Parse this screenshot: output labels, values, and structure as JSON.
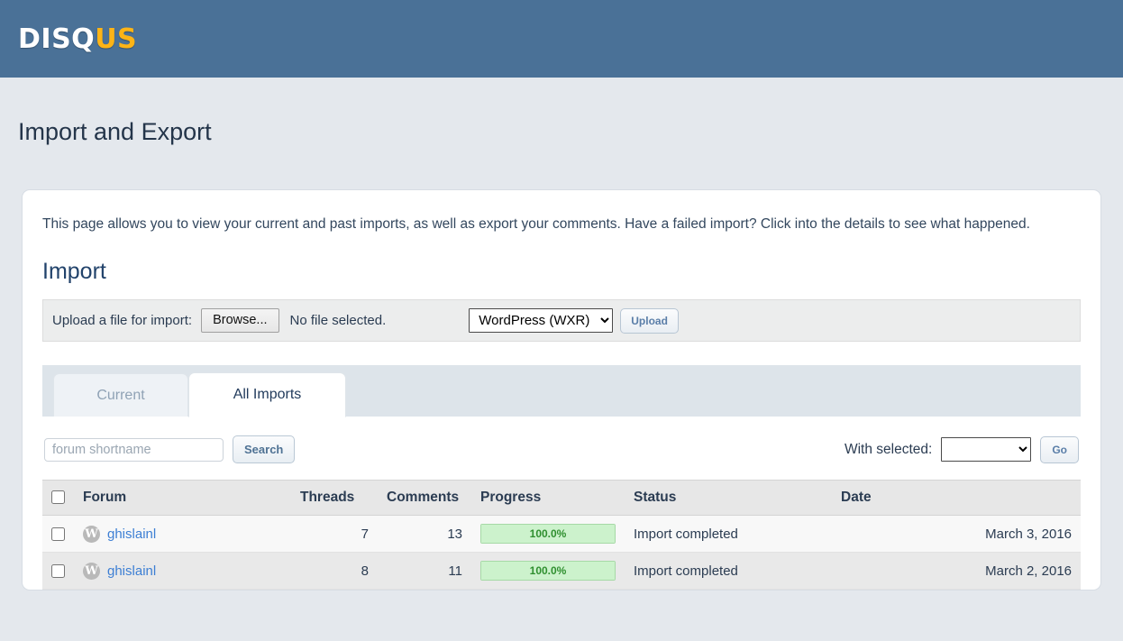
{
  "brand": {
    "logo_white": "DISQ",
    "logo_orange": "US"
  },
  "page": {
    "title": "Import and Export",
    "intro": "This page allows you to view your current and past imports, as well as export your comments. Have a failed import? Click into the details to see what happened."
  },
  "import_section": {
    "heading": "Import",
    "upload_label": "Upload a file for import:",
    "browse_button": "Browse...",
    "no_file_text": "No file selected.",
    "format_selected": "WordPress (WXR)",
    "format_options": [
      "WordPress (WXR)"
    ],
    "upload_button": "Upload"
  },
  "tabs": [
    {
      "label": "Current",
      "active": false
    },
    {
      "label": "All Imports",
      "active": true
    }
  ],
  "controls": {
    "search_placeholder": "forum shortname",
    "search_value": "",
    "search_button": "Search",
    "with_selected_label": "With selected:",
    "with_selected_value": "",
    "with_selected_options": [
      ""
    ],
    "go_button": "Go"
  },
  "table": {
    "columns": [
      "",
      "Forum",
      "Threads",
      "Comments",
      "Progress",
      "Status",
      "Date"
    ],
    "rows": [
      {
        "checked": false,
        "platform_icon": "wordpress-icon",
        "forum": "ghislainl",
        "threads": "7",
        "comments": "13",
        "progress_text": "100.0%",
        "progress_value": 100,
        "status": "Import completed",
        "date": "March 3, 2016"
      },
      {
        "checked": false,
        "platform_icon": "wordpress-icon",
        "forum": "ghislainl",
        "threads": "8",
        "comments": "11",
        "progress_text": "100.0%",
        "progress_value": 100,
        "status": "Import completed",
        "date": "March 2, 2016"
      }
    ]
  },
  "colors": {
    "brand_bar": "#4a7197",
    "brand_orange": "#fdb416",
    "page_bg": "#e4e8ed",
    "link": "#3d7fd4",
    "progress_fill": "#ccf2cc",
    "progress_text": "#2f8f2f"
  }
}
